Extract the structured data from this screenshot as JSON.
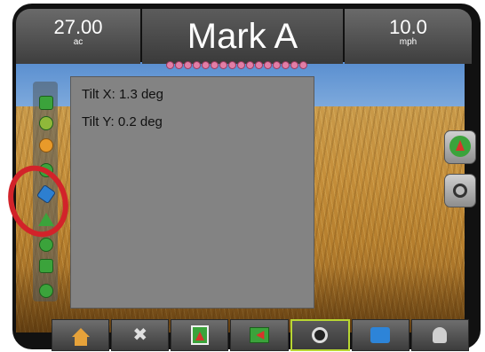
{
  "header": {
    "area_value": "27.00",
    "area_unit": "ac",
    "title": "Mark A",
    "speed_value": "10.0",
    "speed_unit": "mph"
  },
  "tilt_panel": {
    "tilt_x": "Tilt X: 1.3 deg",
    "tilt_y": "Tilt Y: 0.2 deg"
  },
  "lightbar_dots": 16,
  "left_toolbar": {
    "items": [
      "boom-icon",
      "speed-icon",
      "alert-icon",
      "tractor-icon",
      "tilt-icon",
      "guidance-triangle-icon",
      "steering-icon",
      "section-icon",
      "link-icon"
    ]
  },
  "right_toolbar": {
    "items": [
      "vehicle-view-icon",
      "camera-icon"
    ]
  },
  "bottom_nav": {
    "items": [
      {
        "name": "home-icon",
        "active": false
      },
      {
        "name": "tools-icon",
        "active": false
      },
      {
        "name": "vehicle-view-icon",
        "active": false
      },
      {
        "name": "field-view-icon",
        "active": false
      },
      {
        "name": "camera-icon",
        "active": true
      },
      {
        "name": "data-icon",
        "active": false
      },
      {
        "name": "unlock-icon",
        "active": false
      }
    ]
  },
  "colors": {
    "accent_green": "#3ba33b",
    "active_border": "#b8d632",
    "annotation_red": "#d2232a",
    "lightbar_dot": "#e27ea5"
  }
}
